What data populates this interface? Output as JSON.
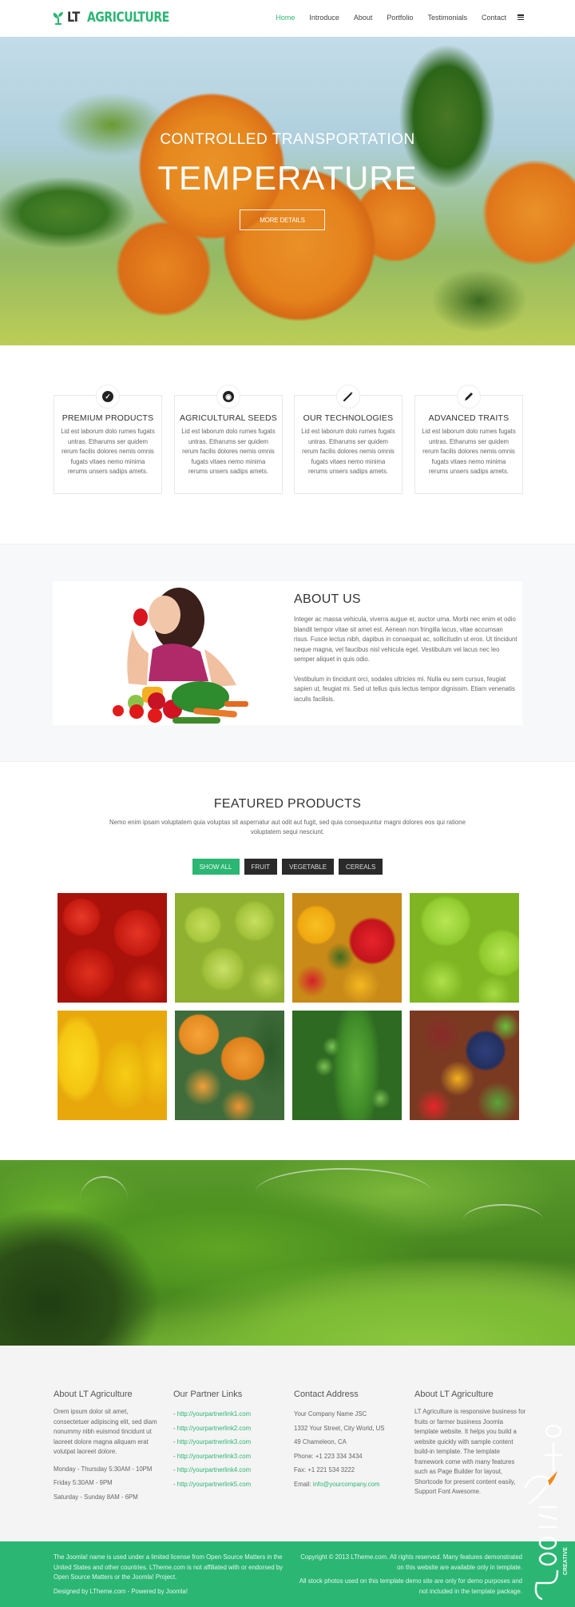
{
  "header": {
    "logo_prefix": "LT",
    "logo_name": "AGRICULTURE",
    "nav": [
      {
        "label": "Home",
        "active": true
      },
      {
        "label": "Introduce",
        "active": false
      },
      {
        "label": "About",
        "active": false
      },
      {
        "label": "Portfolio",
        "active": false
      },
      {
        "label": "Testimonials",
        "active": false
      },
      {
        "label": "Contact",
        "active": false
      }
    ],
    "menu_icon": "hamburger-icon"
  },
  "hero": {
    "subtitle": "CONTROLLED TRANSPORTATION",
    "title": "TEMPERATURE",
    "button": "MORE DETAILS"
  },
  "features": [
    {
      "icon": "check-circle-icon",
      "title": "PREMIUM PRODUCTS",
      "text": "Lid est laborum dolo rumes fugats untras. Etharums ser quidem rerum facilis dolores nemis omnis fugats vitaes nemo minima rerums unsers sadips amets."
    },
    {
      "icon": "globe-icon",
      "title": "AGRICULTURAL SEEDS",
      "text": "Lid est laborum dolo rumes fugats untras. Etharums ser quidem rerum facilis dolores nemis omnis fugats vitaes nemo minima rerums unsers sadips amets."
    },
    {
      "icon": "magic-wand-icon",
      "title": "OUR TECHNOLOGIES",
      "text": "Lid est laborum dolo rumes fugats untras. Etharums ser quidem rerum facilis dolores nemis omnis fugats vitaes nemo minima rerums unsers sadips amets."
    },
    {
      "icon": "pencil-icon",
      "title": "ADVANCED TRAITS",
      "text": "Lid est laborum dolo rumes fugats untras. Etharums ser quidem rerum facilis dolores nemis omnis fugats vitaes nemo minima rerums unsers sadips amets."
    }
  ],
  "about": {
    "title": "ABOUT US",
    "paragraphs": [
      "Integer ac massa vehicula, viverra augue et, auctor urna. Morbi nec enim et odio blandit tempor vitae sit amet est. Aenean non fringilla lacus, vitae accumsan risus. Fusce lectus nibh, dapibus in consequat ac, sollicitudin ut eros. Ut tincidunt neque magna, vel faucibus nisl vehicula eget. Vestibulum vel lacus nec leo semper aliquet in quis odio.",
      "Vestibulum in tincidunt orci, sodales ultricies mi. Nulla eu sem cursus, feugiat sapien ut, feugiat mi. Sed ut tellus quis lectus tempor dignissim. Etiam venenatis iaculis facilisis."
    ]
  },
  "featured": {
    "title": "FEATURED PRODUCTS",
    "subtitle": "Nemo enim ipsam voluptatem quia voluptas sit aspernatur aut odit aut fugit, sed quia consequuntur magni dolores eos qui ratione voluptatem sequi nesciunt.",
    "filters": [
      {
        "label": "SHOW ALL",
        "active": true
      },
      {
        "label": "FRUIT",
        "active": false
      },
      {
        "label": "VEGETABLE",
        "active": false
      },
      {
        "label": "CEREALS",
        "active": false
      }
    ],
    "products": [
      {
        "name": "tomatoes"
      },
      {
        "name": "green-peppers"
      },
      {
        "name": "mixed-peppers"
      },
      {
        "name": "green-apples"
      },
      {
        "name": "yellow-peppers"
      },
      {
        "name": "oranges"
      },
      {
        "name": "peas"
      },
      {
        "name": "mixed-vegetables"
      }
    ]
  },
  "footer": {
    "about": {
      "title": "About LT Agriculture",
      "text": "Orem ipsum dolor sit amet, consectetuer adipiscing elit, sed diam nonummy nibh euismod tincidunt ut laoreet dolore magna aliquam erat volutpat laoreet dolore.",
      "hours": [
        "Monday - Thursday 5:30AM - 10PM",
        "Friday 5:30AM - 9PM",
        "Saturday - Sunday 8AM - 6PM"
      ]
    },
    "partners": {
      "title": "Our Partner Links",
      "prefix": "- ",
      "links": [
        "http://yourpartnerlink1.com",
        "http://yourpartnerlink2.com",
        "http://yourpartnerlink3.com",
        "http://yourpartnerlink3.com",
        "http://yourpartnerlink4.com",
        "http://yourpartnerlink5.com"
      ]
    },
    "contact": {
      "title": "Contact Address",
      "company": "Your Company Name JSC",
      "street": "1332 Your Street, City World, US",
      "city": "49 Chameleon, CA",
      "phone": "Phone: +1 223 334 3434",
      "fax": "Fax: +1 221 534 3222",
      "email_label": "Email: ",
      "email": "info@yourcompany.com"
    },
    "about2": {
      "title": "About LT Agriculture",
      "text": "LT Agriculture is responsive business for fruits or farmer business Joomla template website. It helps you build a website quickly with sample content build-in template. The template framework come with many features such as Page Builder for layout, Shortcode for present content easily, Support Font Awesome."
    },
    "bottom": {
      "left": [
        "The Joomla! name is used under a limited license from Open Source Matters in the United States and other countries. LTheme.com is not affiliated with or endorsed by Open Source Matters or the Joomla! Project.",
        "Designed by LTheme.com - Powered by Joomla!"
      ],
      "right": [
        "Copyright © 2013 LTheme.com. All rights reserved. Many features demonstrated on this website are available only in template.",
        "All stock photos used on this template demo site are only for demo purposes and not included in the template package."
      ]
    },
    "watermark": "JoomFox CREATIVE STUDIO"
  },
  "colors": {
    "accent": "#2bb673",
    "dark_button": "#2a2a2a",
    "footer_bg": "#f4f4f4",
    "about_bg": "#f7f8fa"
  }
}
